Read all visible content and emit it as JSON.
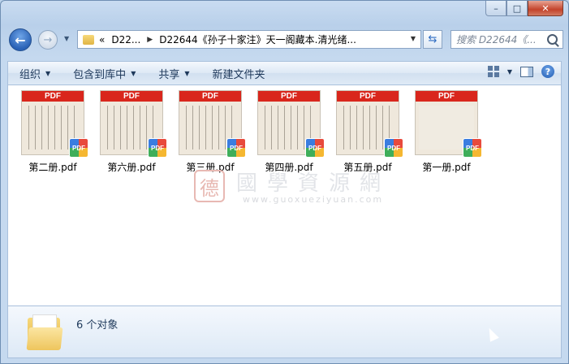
{
  "caption": {
    "minimize": "–",
    "maximize": "□",
    "close": "✕"
  },
  "nav": {
    "address_parts": [
      "«",
      "D22...",
      "D22644《孙子十家注》天一阁藏本.清光绪..."
    ],
    "search_placeholder": "搜索 D22644《..."
  },
  "toolbar": {
    "organize": "组织",
    "include_in_library": "包含到库中",
    "share": "共享",
    "new_folder": "新建文件夹"
  },
  "files": [
    {
      "name": "第二册.pdf",
      "badge": "PDF",
      "thumb_label": "PDF"
    },
    {
      "name": "第六册.pdf",
      "badge": "PDF",
      "thumb_label": "PDF"
    },
    {
      "name": "第三册.pdf",
      "badge": "PDF",
      "thumb_label": "PDF"
    },
    {
      "name": "第四册.pdf",
      "badge": "PDF",
      "thumb_label": "PDF"
    },
    {
      "name": "第五册.pdf",
      "badge": "PDF",
      "thumb_label": "PDF"
    },
    {
      "name": "第一册.pdf",
      "badge": "PDF",
      "thumb_label": "PDF"
    }
  ],
  "watermark": {
    "seal": "德",
    "title": "國學資源網",
    "url": "www.guoxueziyuan.com"
  },
  "status": {
    "object_count": "6 个对象"
  },
  "colors": {
    "pdf_band": "#d9261c",
    "window_frame": "#bcd3ec"
  }
}
